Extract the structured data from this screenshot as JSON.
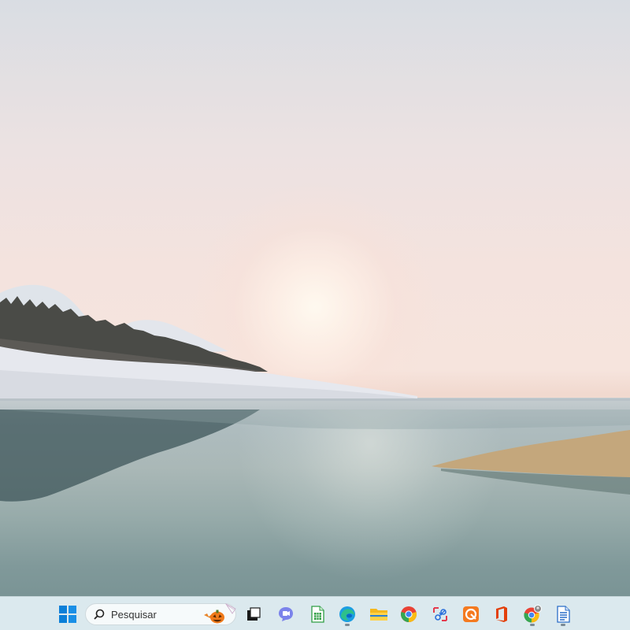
{
  "taskbar": {
    "search": {
      "placeholder": "Pesquisar"
    },
    "icons": [
      {
        "name": "start-menu-icon"
      },
      {
        "name": "search-icon"
      },
      {
        "name": "task-view-icon"
      },
      {
        "name": "meet-chat-icon"
      },
      {
        "name": "libreoffice-calc-icon"
      },
      {
        "name": "edge-browser-icon"
      },
      {
        "name": "file-explorer-icon"
      },
      {
        "name": "chrome-icon"
      },
      {
        "name": "snipping-tool-icon"
      },
      {
        "name": "vpn-app-icon"
      },
      {
        "name": "office-icon"
      },
      {
        "name": "chrome-profile-icon"
      },
      {
        "name": "libreoffice-writer-icon"
      }
    ],
    "colors": {
      "background": "#dbe9ee",
      "accent": "#0078d4"
    }
  }
}
